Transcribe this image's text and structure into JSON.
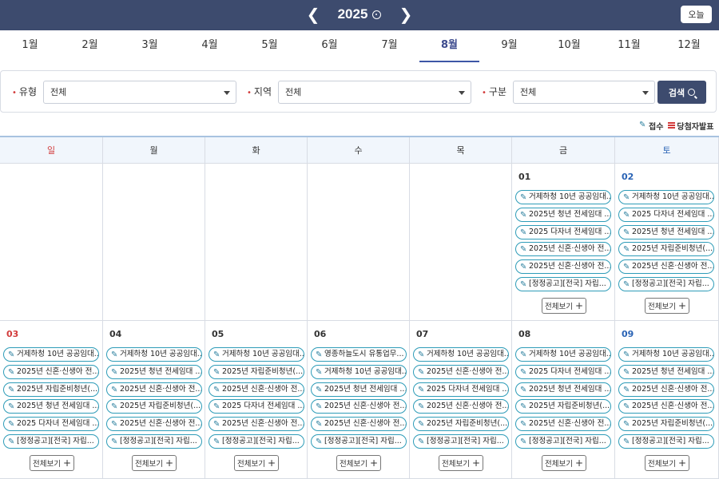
{
  "header": {
    "year": "2025",
    "prev_icon": "chevron-left-icon",
    "next_icon": "chevron-right-icon",
    "today_label": "오늘"
  },
  "months": [
    "1월",
    "2월",
    "3월",
    "4월",
    "5월",
    "6월",
    "7월",
    "8월",
    "9월",
    "10월",
    "11월",
    "12월"
  ],
  "active_month_index": 7,
  "filters": {
    "type_label": "유형",
    "type_value": "전체",
    "region_label": "지역",
    "region_value": "전체",
    "category_label": "구분",
    "category_value": "전체",
    "search_label": "검색"
  },
  "legend": {
    "receipt_label": "접수",
    "winner_label": "당첨자발표"
  },
  "weekdays": [
    "일",
    "월",
    "화",
    "수",
    "목",
    "금",
    "토"
  ],
  "more_label": "전체보기",
  "week1": [
    {
      "date": "",
      "events": []
    },
    {
      "date": "",
      "events": []
    },
    {
      "date": "",
      "events": []
    },
    {
      "date": "",
      "events": []
    },
    {
      "date": "",
      "events": []
    },
    {
      "date": "01",
      "events": [
        "거제하청 10년 공공임대...",
        "2025년 청년 전세임대 ...",
        "2025 다자녀 전세임대 ...",
        "2025년 신혼·신생아 전...",
        "2025년 신혼·신생아 전...",
        "[정정공고][전국] 자립..."
      ]
    },
    {
      "date": "02",
      "events": [
        "거제하청 10년 공공임대...",
        "2025 다자녀 전세임대 ...",
        "2025년 청년 전세임대 ...",
        "2025년 자립준비청년(...",
        "2025년 신혼·신생아 전...",
        "[정정공고][전국] 자립..."
      ]
    }
  ],
  "week2": [
    {
      "date": "03",
      "events": [
        "거제하청 10년 공공임대...",
        "2025년 신혼·신생아 전...",
        "2025년 자립준비청년(...",
        "2025년 청년 전세임대 ...",
        "2025 다자녀 전세임대 ...",
        "[정정공고][전국] 자립..."
      ]
    },
    {
      "date": "04",
      "events": [
        "거제하청 10년 공공임대...",
        "2025년 청년 전세임대 ...",
        "2025년 신혼·신생아 전...",
        "2025년 자립준비청년(...",
        "2025년 신혼·신생아 전...",
        "[정정공고][전국] 자립..."
      ]
    },
    {
      "date": "05",
      "events": [
        "거제하청 10년 공공임대...",
        "2025년 자립준비청년(...",
        "2025년 신혼·신생아 전...",
        "2025 다자녀 전세임대 ...",
        "2025년 신혼·신생아 전...",
        "[정정공고][전국] 자립..."
      ]
    },
    {
      "date": "06",
      "events": [
        "영종하늘도시 유통업무...",
        "거제하청 10년 공공임대...",
        "2025년 청년 전세임대 ...",
        "2025년 신혼·신생아 전...",
        "2025년 신혼·신생아 전...",
        "[정정공고][전국] 자립..."
      ]
    },
    {
      "date": "07",
      "events": [
        "거제하청 10년 공공임대...",
        "2025년 신혼·신생아 전...",
        "2025 다자녀 전세임대 ...",
        "2025년 신혼·신생아 전...",
        "2025년 자립준비청년(...",
        "[정정공고][전국] 자립..."
      ]
    },
    {
      "date": "08",
      "events": [
        "거제하청 10년 공공임대...",
        "2025 다자녀 전세임대 ...",
        "2025년 청년 전세임대 ...",
        "2025년 자립준비청년(...",
        "2025년 신혼·신생아 전...",
        "[정정공고][전국] 자립..."
      ]
    },
    {
      "date": "09",
      "events": [
        "거제하청 10년 공공임대...",
        "2025년 청년 전세임대 ...",
        "2025년 신혼·신생아 전...",
        "2025년 신혼·신생아 전...",
        "2025년 자립준비청년(...",
        "[정정공고][전국] 자립..."
      ]
    }
  ]
}
